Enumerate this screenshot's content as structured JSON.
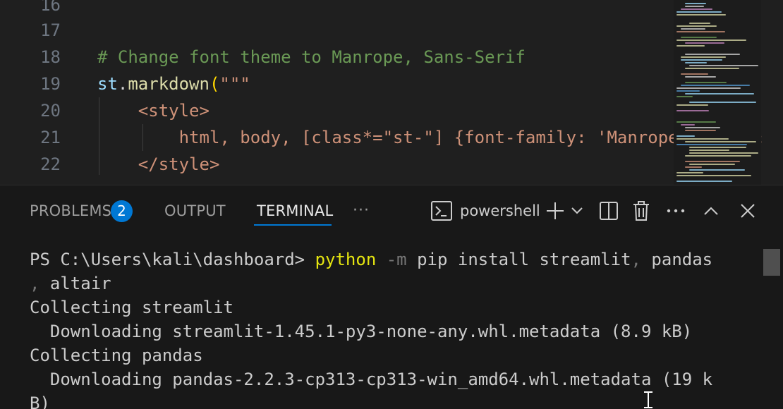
{
  "editor": {
    "lines": [
      {
        "number": "16",
        "segments": []
      },
      {
        "number": "17",
        "segments": []
      },
      {
        "number": "18",
        "segments": [
          {
            "text": "# Change font theme to Manrope, Sans-Serif",
            "cls": "c-comment"
          }
        ]
      },
      {
        "number": "19",
        "segments": [
          {
            "text": "st",
            "cls": "c-var"
          },
          {
            "text": ".",
            "cls": "c-punc"
          },
          {
            "text": "markdown",
            "cls": "c-func"
          },
          {
            "text": "(",
            "cls": "c-paren"
          },
          {
            "text": "\"\"\"",
            "cls": "c-str"
          }
        ]
      },
      {
        "number": "20",
        "segments": [
          {
            "text": "    ",
            "cls": "c-str"
          },
          {
            "text": "<style>",
            "cls": "c-str"
          }
        ]
      },
      {
        "number": "21",
        "segments": [
          {
            "text": "        html, body, [class*=\"st-\"] {font-family: 'Manrope', sans-serif;}",
            "cls": "c-str"
          }
        ]
      },
      {
        "number": "22",
        "segments": [
          {
            "text": "    ",
            "cls": "c-str"
          },
          {
            "text": "</style>",
            "cls": "c-str"
          }
        ]
      }
    ]
  },
  "panel": {
    "tabs": {
      "problems": "PROBLEMS",
      "problems_count": "2",
      "output": "OUTPUT",
      "terminal": "TERMINAL",
      "more": "···"
    },
    "shell": "powershell",
    "icons": [
      "terminal-icon",
      "plus-icon",
      "chevron-down-icon",
      "split-icon",
      "trash-icon",
      "more-icon",
      "chevron-up-icon",
      "close-icon"
    ]
  },
  "terminal": {
    "prompt": "PS C:\\Users\\kali\\dashboard> ",
    "cmd_python": "python",
    "cmd_flag": " -m",
    "cmd_rest": " pip install streamlit",
    "cmd_comma": ",",
    "cmd_pandas": " pandas",
    "wrap1": ", ",
    "wrap1_altair": "altair",
    "out1": "Collecting streamlit",
    "out2": "  Downloading streamlit-1.45.1-py3-none-any.whl.metadata (8.9 kB)",
    "out3": "Collecting pandas",
    "out4": "  Downloading pandas-2.2.3-cp313-cp313-win_amd64.whl.metadata (19 k",
    "out5": "B)"
  },
  "colors": {
    "accent": "#0078d4",
    "python": "#e5e510",
    "comment": "#6a9955",
    "string": "#ce9178"
  }
}
